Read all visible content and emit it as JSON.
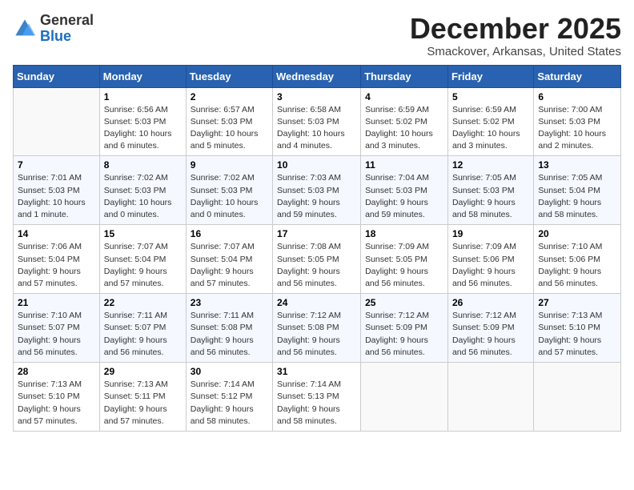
{
  "header": {
    "logo_general": "General",
    "logo_blue": "Blue",
    "month_title": "December 2025",
    "location": "Smackover, Arkansas, United States"
  },
  "days_of_week": [
    "Sunday",
    "Monday",
    "Tuesday",
    "Wednesday",
    "Thursday",
    "Friday",
    "Saturday"
  ],
  "weeks": [
    [
      {
        "day": "",
        "sunrise": "",
        "sunset": "",
        "daylight": ""
      },
      {
        "day": "1",
        "sunrise": "Sunrise: 6:56 AM",
        "sunset": "Sunset: 5:03 PM",
        "daylight": "Daylight: 10 hours and 6 minutes."
      },
      {
        "day": "2",
        "sunrise": "Sunrise: 6:57 AM",
        "sunset": "Sunset: 5:03 PM",
        "daylight": "Daylight: 10 hours and 5 minutes."
      },
      {
        "day": "3",
        "sunrise": "Sunrise: 6:58 AM",
        "sunset": "Sunset: 5:03 PM",
        "daylight": "Daylight: 10 hours and 4 minutes."
      },
      {
        "day": "4",
        "sunrise": "Sunrise: 6:59 AM",
        "sunset": "Sunset: 5:02 PM",
        "daylight": "Daylight: 10 hours and 3 minutes."
      },
      {
        "day": "5",
        "sunrise": "Sunrise: 6:59 AM",
        "sunset": "Sunset: 5:02 PM",
        "daylight": "Daylight: 10 hours and 3 minutes."
      },
      {
        "day": "6",
        "sunrise": "Sunrise: 7:00 AM",
        "sunset": "Sunset: 5:03 PM",
        "daylight": "Daylight: 10 hours and 2 minutes."
      }
    ],
    [
      {
        "day": "7",
        "sunrise": "Sunrise: 7:01 AM",
        "sunset": "Sunset: 5:03 PM",
        "daylight": "Daylight: 10 hours and 1 minute."
      },
      {
        "day": "8",
        "sunrise": "Sunrise: 7:02 AM",
        "sunset": "Sunset: 5:03 PM",
        "daylight": "Daylight: 10 hours and 0 minutes."
      },
      {
        "day": "9",
        "sunrise": "Sunrise: 7:02 AM",
        "sunset": "Sunset: 5:03 PM",
        "daylight": "Daylight: 10 hours and 0 minutes."
      },
      {
        "day": "10",
        "sunrise": "Sunrise: 7:03 AM",
        "sunset": "Sunset: 5:03 PM",
        "daylight": "Daylight: 9 hours and 59 minutes."
      },
      {
        "day": "11",
        "sunrise": "Sunrise: 7:04 AM",
        "sunset": "Sunset: 5:03 PM",
        "daylight": "Daylight: 9 hours and 59 minutes."
      },
      {
        "day": "12",
        "sunrise": "Sunrise: 7:05 AM",
        "sunset": "Sunset: 5:03 PM",
        "daylight": "Daylight: 9 hours and 58 minutes."
      },
      {
        "day": "13",
        "sunrise": "Sunrise: 7:05 AM",
        "sunset": "Sunset: 5:04 PM",
        "daylight": "Daylight: 9 hours and 58 minutes."
      }
    ],
    [
      {
        "day": "14",
        "sunrise": "Sunrise: 7:06 AM",
        "sunset": "Sunset: 5:04 PM",
        "daylight": "Daylight: 9 hours and 57 minutes."
      },
      {
        "day": "15",
        "sunrise": "Sunrise: 7:07 AM",
        "sunset": "Sunset: 5:04 PM",
        "daylight": "Daylight: 9 hours and 57 minutes."
      },
      {
        "day": "16",
        "sunrise": "Sunrise: 7:07 AM",
        "sunset": "Sunset: 5:04 PM",
        "daylight": "Daylight: 9 hours and 57 minutes."
      },
      {
        "day": "17",
        "sunrise": "Sunrise: 7:08 AM",
        "sunset": "Sunset: 5:05 PM",
        "daylight": "Daylight: 9 hours and 56 minutes."
      },
      {
        "day": "18",
        "sunrise": "Sunrise: 7:09 AM",
        "sunset": "Sunset: 5:05 PM",
        "daylight": "Daylight: 9 hours and 56 minutes."
      },
      {
        "day": "19",
        "sunrise": "Sunrise: 7:09 AM",
        "sunset": "Sunset: 5:06 PM",
        "daylight": "Daylight: 9 hours and 56 minutes."
      },
      {
        "day": "20",
        "sunrise": "Sunrise: 7:10 AM",
        "sunset": "Sunset: 5:06 PM",
        "daylight": "Daylight: 9 hours and 56 minutes."
      }
    ],
    [
      {
        "day": "21",
        "sunrise": "Sunrise: 7:10 AM",
        "sunset": "Sunset: 5:07 PM",
        "daylight": "Daylight: 9 hours and 56 minutes."
      },
      {
        "day": "22",
        "sunrise": "Sunrise: 7:11 AM",
        "sunset": "Sunset: 5:07 PM",
        "daylight": "Daylight: 9 hours and 56 minutes."
      },
      {
        "day": "23",
        "sunrise": "Sunrise: 7:11 AM",
        "sunset": "Sunset: 5:08 PM",
        "daylight": "Daylight: 9 hours and 56 minutes."
      },
      {
        "day": "24",
        "sunrise": "Sunrise: 7:12 AM",
        "sunset": "Sunset: 5:08 PM",
        "daylight": "Daylight: 9 hours and 56 minutes."
      },
      {
        "day": "25",
        "sunrise": "Sunrise: 7:12 AM",
        "sunset": "Sunset: 5:09 PM",
        "daylight": "Daylight: 9 hours and 56 minutes."
      },
      {
        "day": "26",
        "sunrise": "Sunrise: 7:12 AM",
        "sunset": "Sunset: 5:09 PM",
        "daylight": "Daylight: 9 hours and 56 minutes."
      },
      {
        "day": "27",
        "sunrise": "Sunrise: 7:13 AM",
        "sunset": "Sunset: 5:10 PM",
        "daylight": "Daylight: 9 hours and 57 minutes."
      }
    ],
    [
      {
        "day": "28",
        "sunrise": "Sunrise: 7:13 AM",
        "sunset": "Sunset: 5:10 PM",
        "daylight": "Daylight: 9 hours and 57 minutes."
      },
      {
        "day": "29",
        "sunrise": "Sunrise: 7:13 AM",
        "sunset": "Sunset: 5:11 PM",
        "daylight": "Daylight: 9 hours and 57 minutes."
      },
      {
        "day": "30",
        "sunrise": "Sunrise: 7:14 AM",
        "sunset": "Sunset: 5:12 PM",
        "daylight": "Daylight: 9 hours and 58 minutes."
      },
      {
        "day": "31",
        "sunrise": "Sunrise: 7:14 AM",
        "sunset": "Sunset: 5:13 PM",
        "daylight": "Daylight: 9 hours and 58 minutes."
      },
      {
        "day": "",
        "sunrise": "",
        "sunset": "",
        "daylight": ""
      },
      {
        "day": "",
        "sunrise": "",
        "sunset": "",
        "daylight": ""
      },
      {
        "day": "",
        "sunrise": "",
        "sunset": "",
        "daylight": ""
      }
    ]
  ]
}
